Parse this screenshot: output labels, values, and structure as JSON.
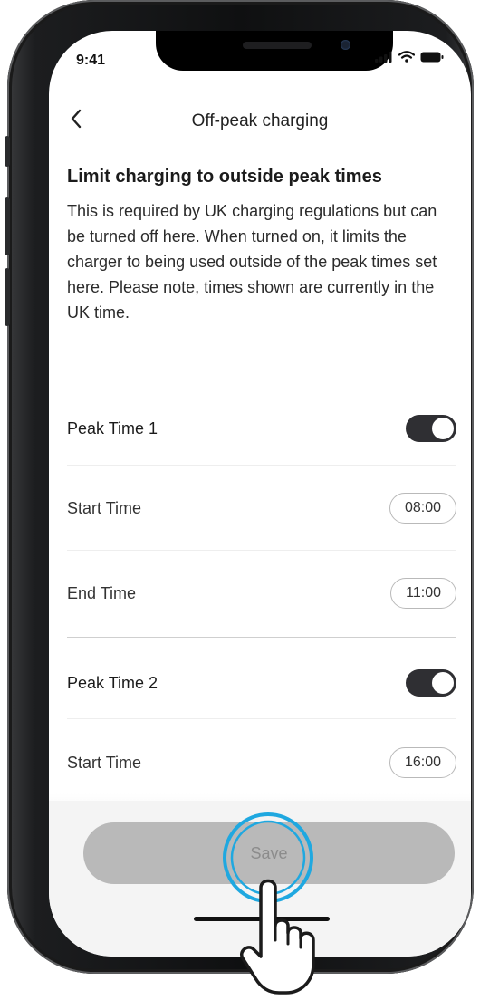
{
  "status_bar": {
    "time": "9:41"
  },
  "header": {
    "title": "Off-peak charging"
  },
  "intro": {
    "heading": "Limit charging to outside peak times",
    "description": "This is required by UK charging regulations but can be turned off here. When turned on, it limits the charger to being used outside of the peak times set here. Please note, times shown are currently in the UK time."
  },
  "peak_times": [
    {
      "label": "Peak Time 1",
      "enabled": true,
      "start_label": "Start Time",
      "start_value": "08:00",
      "end_label": "End Time",
      "end_value": "11:00"
    },
    {
      "label": "Peak Time 2",
      "enabled": true,
      "start_label": "Start Time",
      "start_value": "16:00"
    }
  ],
  "footer": {
    "save_label": "Save"
  },
  "colors": {
    "toggle_on": "#2f2f33",
    "save_disabled": "#b9b9b9",
    "tap_ring": "#1fa8e0"
  }
}
